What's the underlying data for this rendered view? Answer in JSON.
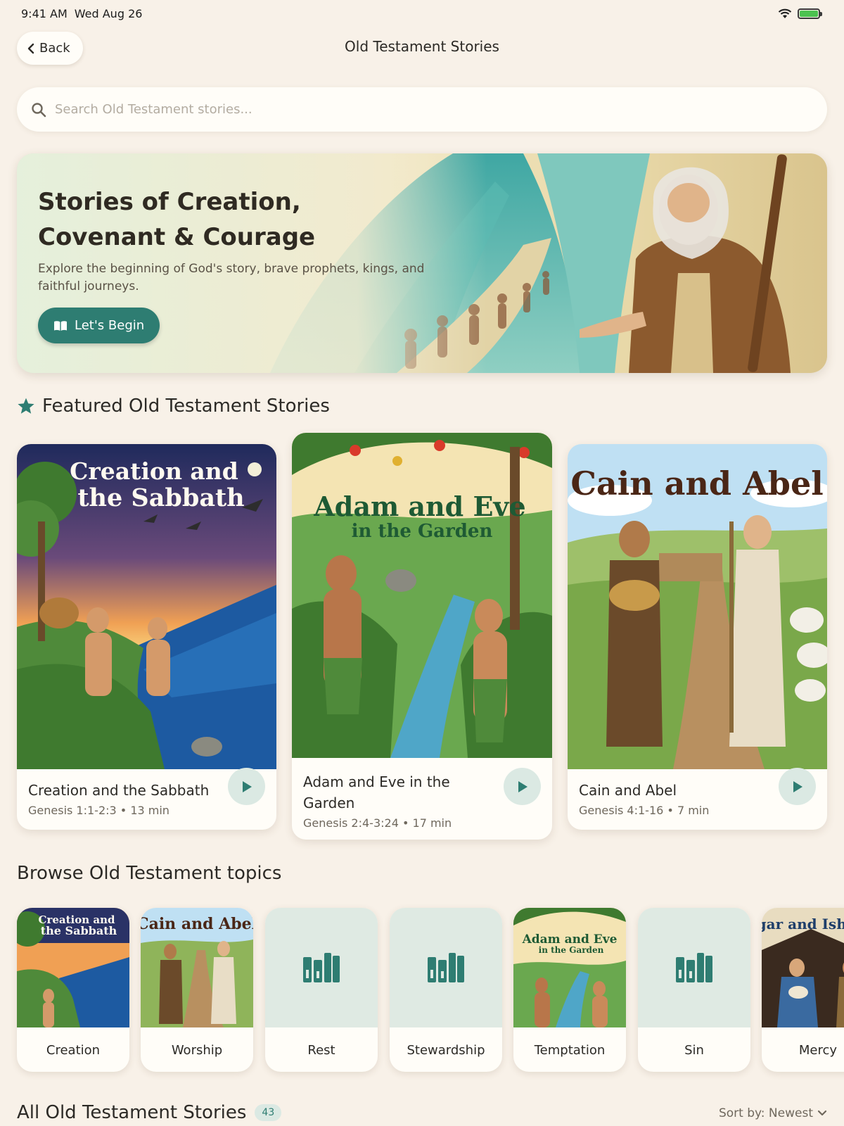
{
  "status": {
    "time": "9:41 AM",
    "date": "Wed Aug 26"
  },
  "header": {
    "back_label": "Back",
    "title": "Old Testament Stories"
  },
  "search": {
    "placeholder": "Search Old Testament stories..."
  },
  "hero": {
    "title": "Stories of Creation, Covenant & Courage",
    "subtitle": "Explore the beginning of God's story, brave prophets, kings, and faithful journeys.",
    "cta_label": "Let's Begin"
  },
  "featured": {
    "title": "Featured Old Testament Stories",
    "stories": [
      {
        "art_title_1": "Creation and",
        "art_title_2": "the Sabbath",
        "name": "Creation and the Sabbath",
        "reference": "Genesis 1:1-2:3",
        "duration": "13 min"
      },
      {
        "art_title_1": "Adam and Eve",
        "art_title_2": "in the Garden",
        "name": "Adam and Eve in the Garden",
        "reference": "Genesis 2:4-3:24",
        "duration": "17 min"
      },
      {
        "art_title_1": "Cain and Abel",
        "art_title_2": "",
        "name": "Cain and Abel",
        "reference": "Genesis 4:1-16",
        "duration": "7 min"
      }
    ]
  },
  "topics": {
    "title": "Browse Old Testament topics",
    "items": [
      {
        "label": "Creation",
        "art": "Creation and the Sabbath"
      },
      {
        "label": "Worship",
        "art": "Cain and Abel"
      },
      {
        "label": "Rest",
        "icon": "books-icon"
      },
      {
        "label": "Stewardship",
        "icon": "books-icon"
      },
      {
        "label": "Temptation",
        "art": "Adam and Eve in the Garden"
      },
      {
        "label": "Sin",
        "icon": "books-icon"
      },
      {
        "label": "Mercy",
        "art": "Hagar and Ishmael"
      }
    ]
  },
  "all_stories": {
    "title": "All Old Testament Stories",
    "count": "43",
    "sort_label": "Sort by: Newest"
  },
  "colors": {
    "accent": "#2e7d72",
    "accent_light": "#dbe9e3",
    "background": "#f8f1e8",
    "card": "#fffdf8"
  }
}
